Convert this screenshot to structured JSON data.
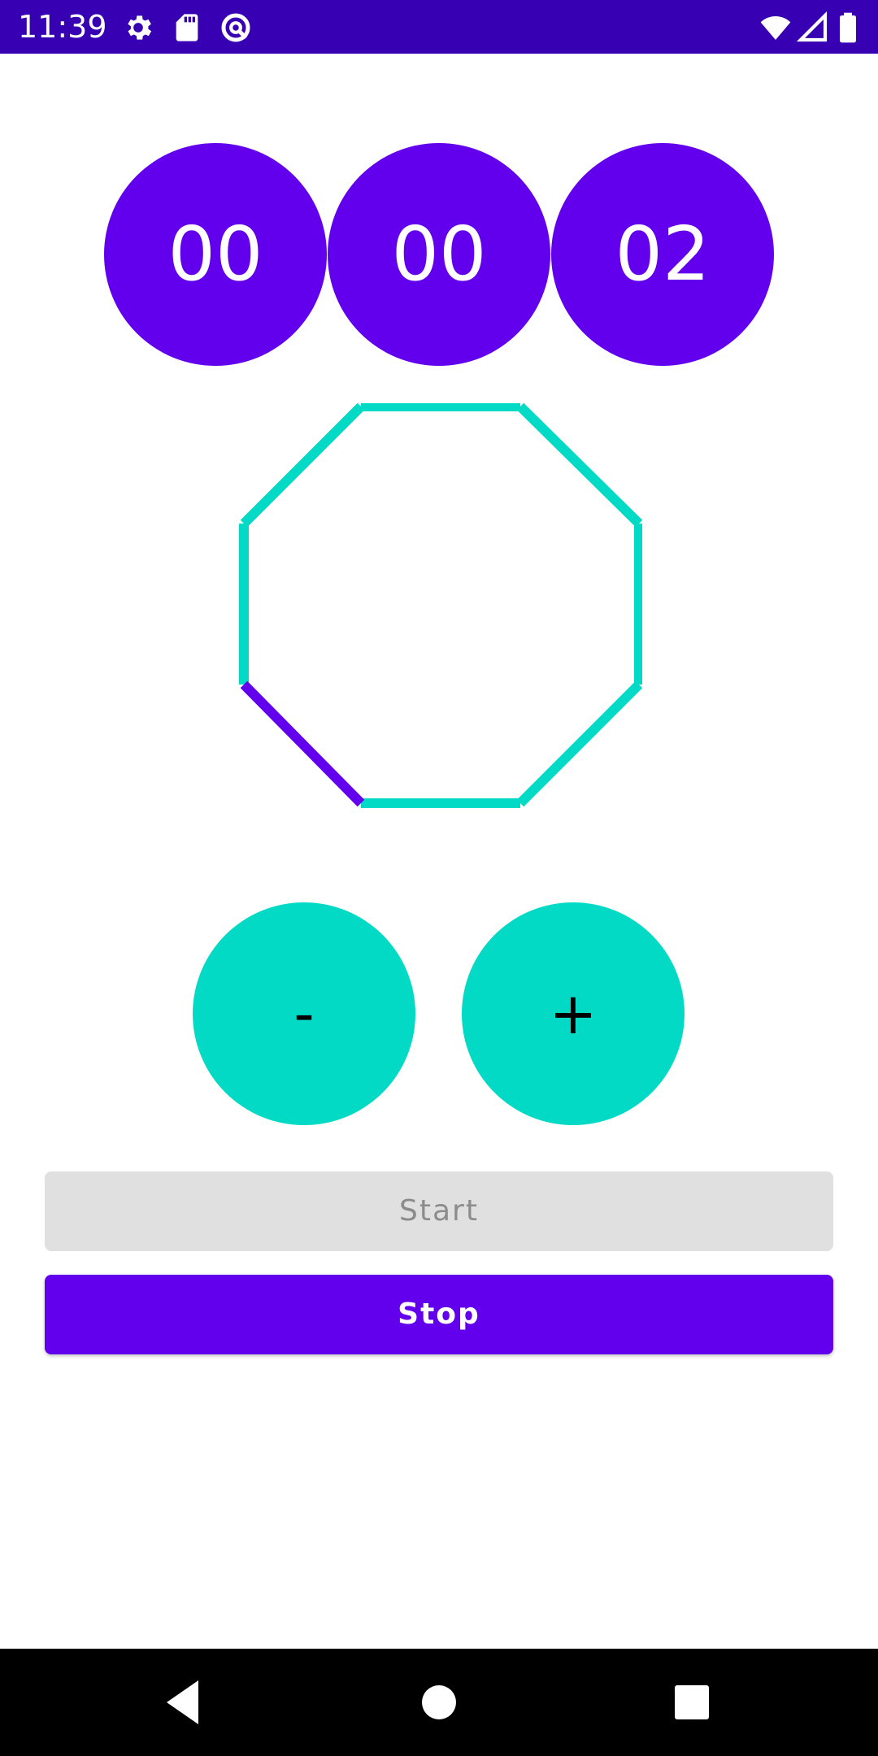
{
  "status_bar": {
    "time": "11:39",
    "left_icons": [
      "settings-icon",
      "sd-card-icon",
      "vpn-icon"
    ],
    "right_icons": [
      "wifi-icon",
      "cell-signal-icon",
      "battery-icon"
    ],
    "background": "#3700b3"
  },
  "timer": {
    "hours": "00",
    "minutes": "00",
    "seconds": "02",
    "circle_color": "#6200ee"
  },
  "progress_octagon": {
    "segments_total": 8,
    "segments_completed": 1,
    "progress_fraction": 0.125,
    "track_color": "#03dac5",
    "progress_color": "#6200ee"
  },
  "controls": {
    "decrement_label": "-",
    "increment_label": "+",
    "button_color": "#03dac5"
  },
  "actions": {
    "start_label": "Start",
    "start_enabled": false,
    "stop_label": "Stop",
    "stop_color": "#6200ee"
  },
  "nav_bar": {
    "buttons": [
      "back-icon",
      "home-icon",
      "recents-icon"
    ]
  }
}
